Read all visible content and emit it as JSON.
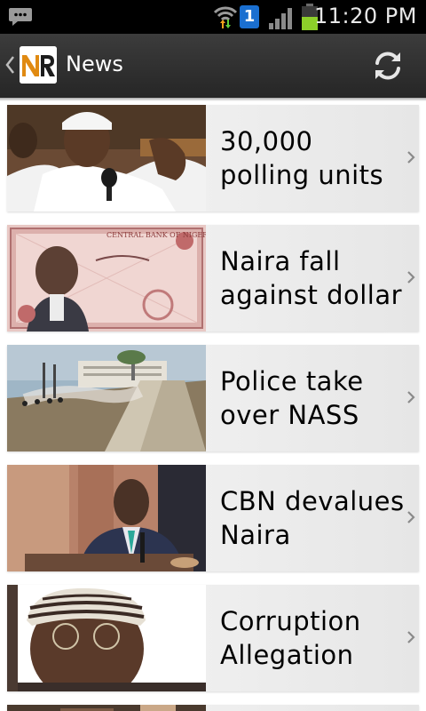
{
  "status_bar": {
    "time": "11:20 PM",
    "sim_number": "1",
    "battery_level": 0.55,
    "icons": [
      "chat-notification-icon",
      "wifi-icon",
      "sim-badge-icon",
      "signal-icon",
      "battery-icon"
    ]
  },
  "action_bar": {
    "title": "News",
    "logo_text": "NR",
    "icons": [
      "back-chevron-icon",
      "app-logo",
      "refresh-icon"
    ]
  },
  "news": {
    "items": [
      {
        "headline": "30,000 polling units"
      },
      {
        "headline": "Naira fall against dollar",
        "thumb_text": "CENTRAL BANK OF NIGERIA"
      },
      {
        "headline": "Police take over NASS"
      },
      {
        "headline": "CBN devalues Naira"
      },
      {
        "headline": "Corruption Allegation"
      }
    ]
  },
  "colors": {
    "status_bar": "#000000",
    "action_bar": "#2e2e2e",
    "battery": "#8ccf2a",
    "sim_badge": "#1a6fd0",
    "logo_accent": "#e08a12"
  }
}
